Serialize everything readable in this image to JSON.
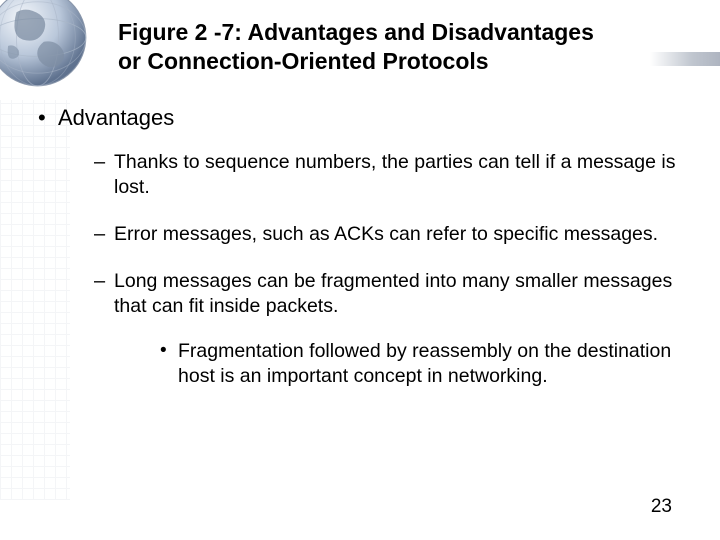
{
  "title_line1": "Figure 2 -7: Advantages and Disadvantages",
  "title_line2": "or Connection-Oriented Protocols",
  "bullets": {
    "l1_0": "Advantages",
    "l2_0": "Thanks to sequence numbers, the parties can tell if a message is lost.",
    "l2_1": "Error messages, such as ACKs can refer to specific messages.",
    "l2_2": "Long messages can be fragmented into many smaller messages that can fit inside packets.",
    "l3_0": "Fragmentation followed by reassembly on the destination host is an important concept in networking."
  },
  "page_number": "23"
}
